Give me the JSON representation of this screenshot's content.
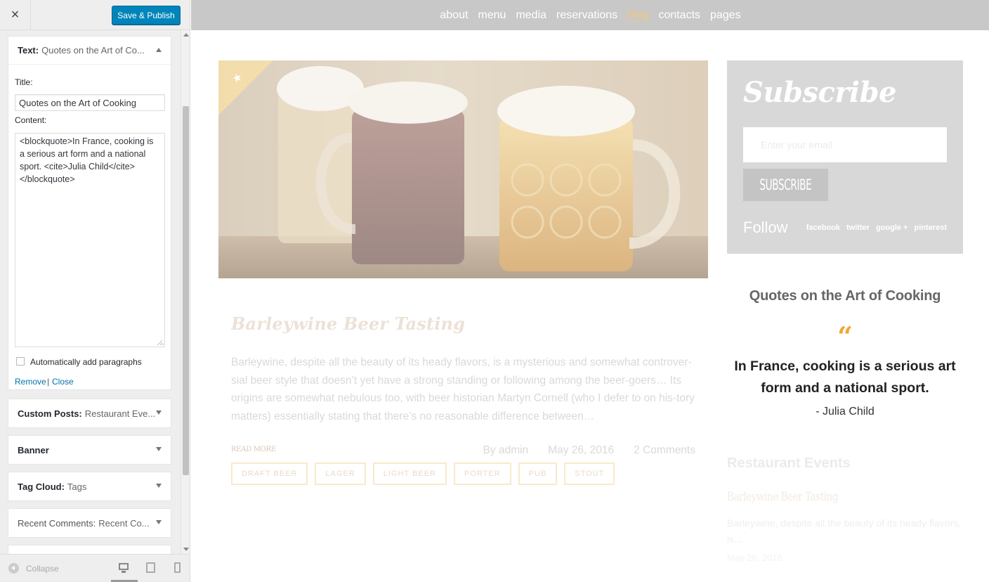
{
  "sidebar": {
    "close_symbol": "×",
    "publish_label": "Save & Publish",
    "text_widget": {
      "type_label": "Text:",
      "title_summary": "Quotes on the Art of Co...",
      "title_label": "Title:",
      "title_value": "Quotes on the Art of Cooking",
      "content_label": "Content:",
      "content_value": "<blockquote>In France, cooking is a serious art form and a national sport. <cite>Julia Child</cite></blockquote>",
      "autop_label": "Automatically add paragraphs",
      "autop_checked": false,
      "remove_label": "Remove",
      "separator": "|",
      "close_label": "Close"
    },
    "widgets": [
      {
        "type": "Custom Posts:",
        "summary": "Restaurant Eve..."
      },
      {
        "type": "Banner",
        "summary": ""
      },
      {
        "type": "Tag Cloud:",
        "summary": "Tags"
      },
      {
        "type": "Recent Comments:",
        "summary": "Recent Co..."
      }
    ],
    "footer": {
      "collapse_label": "Collapse",
      "devices": [
        "desktop-icon",
        "tablet-icon",
        "mobile-icon"
      ]
    }
  },
  "preview": {
    "nav": {
      "items": [
        "about",
        "menu",
        "media",
        "reservations",
        "blog",
        "contacts",
        "pages"
      ],
      "active": "blog"
    },
    "post": {
      "title": "Barleywine Beer Tasting",
      "excerpt": "Barleywine, despite all the beauty of its heady flavors, is a mysterious and somewhat controver-sial beer style that doesn’t yet have a strong standing or following among the beer-goers… Its origins are somewhat nebulous too, with beer historian Martyn Cornell (who I defer to on his-tory matters) essentially stating that there’s no reasonable difference between…",
      "read_more": "READ MORE",
      "author": "By admin",
      "date": "May 26, 2016",
      "comments": "2 Comments",
      "tags": [
        "DRAFT BEER",
        "LAGER",
        "LIGHT BEER",
        "PORTER",
        "PUB",
        "STOUT"
      ]
    },
    "subscribe": {
      "title": "Subscribe",
      "email_placeholder": "Enter your email",
      "button_label": "SUBSCRIBE",
      "follow_label": "Follow",
      "social": [
        "facebook",
        "twitter",
        "google +",
        "pinterest"
      ]
    },
    "quote_widget": {
      "title": "Quotes on the Art of Cooking",
      "mark": "“",
      "text": "In France, cooking is a serious art form and a national sport.",
      "cite": "- Julia Child"
    },
    "events_widget": {
      "title": "Restaurant Events",
      "event_name": "Barleywine Beer Tasting",
      "event_excerpt": "Barleywine, despite all the beauty of its heady flavors, is...",
      "event_date": "May 26, 2016"
    }
  },
  "colors": {
    "publish_blue": "#0085ba",
    "link_blue": "#0073aa",
    "nav_active": "#f1c87c",
    "quote_accent": "#f2a733"
  }
}
